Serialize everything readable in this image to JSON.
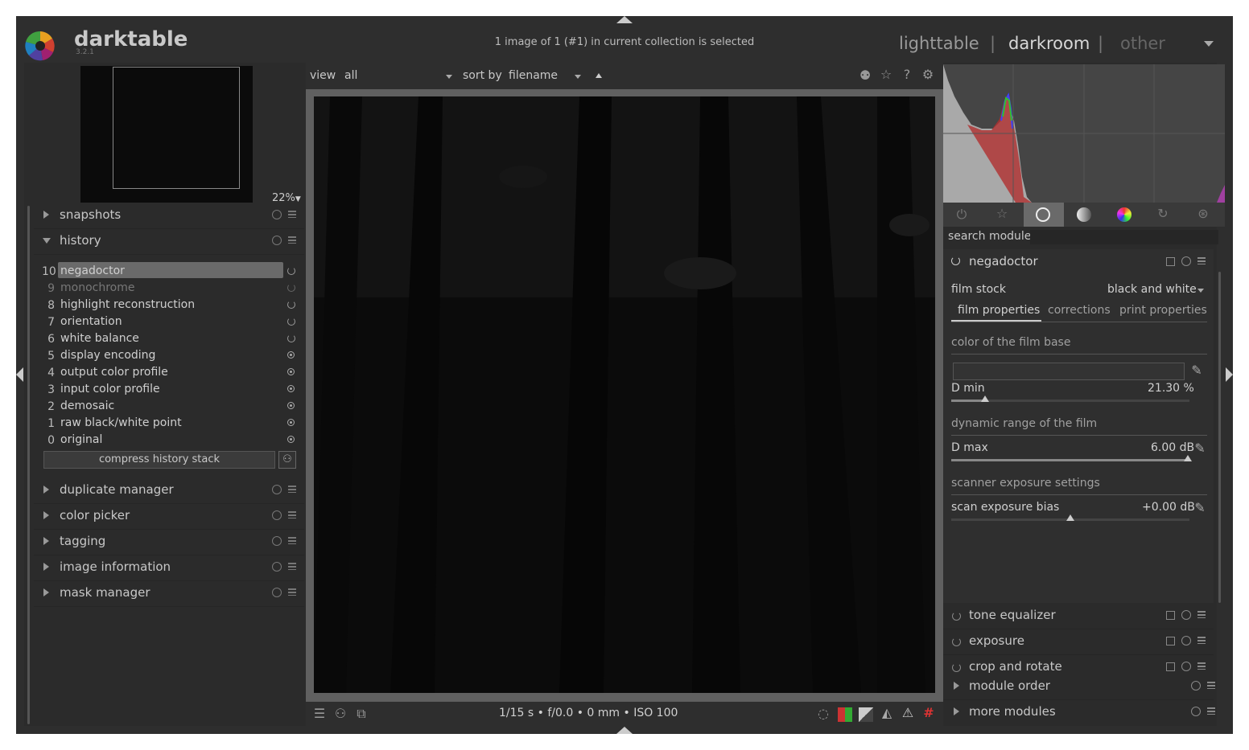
{
  "app": {
    "name": "darktable",
    "version": "3.2.1"
  },
  "header": {
    "message": "1 image of 1 (#1) in current collection is selected",
    "views": [
      "lighttable",
      "darkroom",
      "other"
    ],
    "separator": "|",
    "active_view": "darkroom"
  },
  "navigation": {
    "zoom": "22%"
  },
  "left_modules": {
    "snapshots": "snapshots",
    "history": "history",
    "duplicate_manager": "duplicate manager",
    "color_picker": "color picker",
    "tagging": "tagging",
    "image_information": "image information",
    "mask_manager": "mask manager"
  },
  "history_items": [
    {
      "num": "10",
      "label": "negadoctor"
    },
    {
      "num": "9",
      "label": "monochrome"
    },
    {
      "num": "8",
      "label": "highlight reconstruction"
    },
    {
      "num": "7",
      "label": "orientation"
    },
    {
      "num": "6",
      "label": "white balance"
    },
    {
      "num": "5",
      "label": "display encoding"
    },
    {
      "num": "4",
      "label": "output color profile"
    },
    {
      "num": "3",
      "label": "input color profile"
    },
    {
      "num": "2",
      "label": "demosaic"
    },
    {
      "num": "1",
      "label": "raw black/white point"
    },
    {
      "num": "0",
      "label": "original"
    }
  ],
  "history_compress": "compress history stack",
  "filter_bar": {
    "view_label": "view",
    "view_value": "all",
    "sort_label": "sort by",
    "sort_value": "filename"
  },
  "exif": "1/15 s • f/0.0 • 0 mm • ISO 100",
  "right": {
    "search_label": "search module",
    "negadoctor": {
      "title": "negadoctor",
      "film_stock_label": "film stock",
      "film_stock_value": "black and white",
      "tabs": [
        "film properties",
        "corrections",
        "print properties"
      ],
      "section_base": "color of the film base",
      "dmin_label": "D min",
      "dmin_value": "21.30 %",
      "section_range": "dynamic range of the film",
      "dmax_label": "D max",
      "dmax_value": "6.00 dB",
      "section_scanner": "scanner exposure settings",
      "bias_label": "scan exposure bias",
      "bias_value": "+0.00 dB"
    },
    "modules": {
      "tone_equalizer": "tone equalizer",
      "exposure": "exposure",
      "crop_and_rotate": "crop and rotate",
      "module_order": "module order",
      "more_modules": "more modules"
    }
  },
  "colors": {
    "background": "#2e2e2e",
    "panel": "#2b2b2b",
    "selected_history": "#6a6a6a"
  }
}
